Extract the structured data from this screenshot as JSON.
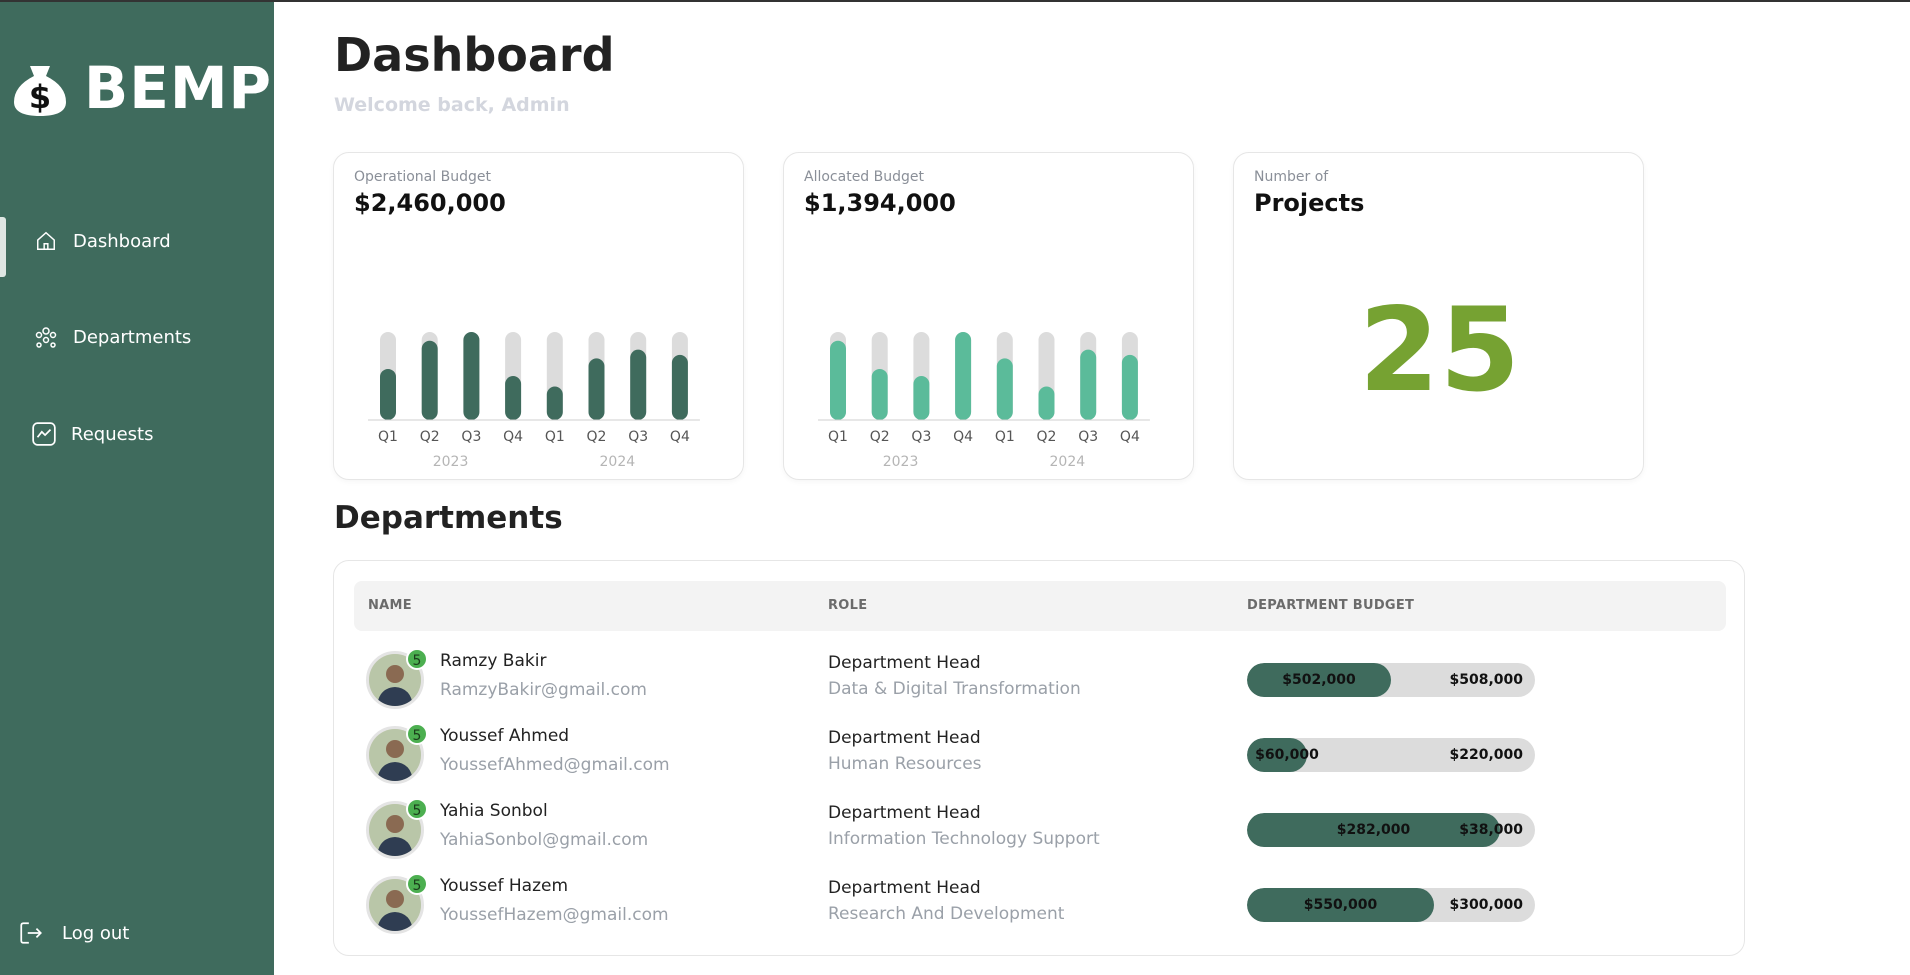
{
  "app": {
    "brand": "BEMP"
  },
  "sidebar": {
    "items": [
      {
        "label": "Dashboard",
        "icon": "home-icon",
        "active": true
      },
      {
        "label": "Departments",
        "icon": "team-icon",
        "active": false
      },
      {
        "label": "Requests",
        "icon": "chart-line-icon",
        "active": false
      }
    ],
    "logout_label": "Log out"
  },
  "header": {
    "title": "Dashboard",
    "subtitle": "Welcome back, Admin"
  },
  "cards": {
    "operational": {
      "label": "Operational Budget",
      "value": "$2,460,000"
    },
    "allocated": {
      "label": "Allocated Budget",
      "value": "$1,394,000"
    },
    "projects": {
      "label": "Number of",
      "value": "Projects",
      "count": "25"
    }
  },
  "chart_data": [
    {
      "type": "bar",
      "title": "",
      "categories": [
        "Q1",
        "Q2",
        "Q3",
        "Q4",
        "Q1",
        "Q2",
        "Q3",
        "Q4"
      ],
      "groups": [
        "2023",
        "2024"
      ],
      "values": [
        0.58,
        0.9,
        1.0,
        0.5,
        0.38,
        0.7,
        0.8,
        0.74
      ],
      "ylim": [
        0,
        1
      ],
      "bar_color": "#3f6b5d",
      "track_color": "#dcdcdc"
    },
    {
      "type": "bar",
      "title": "",
      "categories": [
        "Q1",
        "Q2",
        "Q3",
        "Q4",
        "Q1",
        "Q2",
        "Q3",
        "Q4"
      ],
      "groups": [
        "2023",
        "2024"
      ],
      "values": [
        0.9,
        0.58,
        0.5,
        1.0,
        0.7,
        0.38,
        0.8,
        0.74
      ],
      "ylim": [
        0,
        1
      ],
      "bar_color": "#5bbb9a",
      "track_color": "#dcdcdc"
    }
  ],
  "departments": {
    "title": "Departments",
    "columns": [
      "NAME",
      "ROLE",
      "DEPARTMENT BUDGET"
    ],
    "rows": [
      {
        "name": "Ramzy Bakir",
        "email": "RamzyBakir@gmail.com",
        "badge": "5",
        "role": "Department Head",
        "department": "Data & Digital Transformation",
        "used": "$502,000",
        "remaining": "$508,000",
        "fill": 0.5
      },
      {
        "name": "Youssef Ahmed",
        "email": "YoussefAhmed@gmail.com",
        "badge": "5",
        "role": "Department Head",
        "department": "Human Resources",
        "used": "$60,000",
        "remaining": "$220,000",
        "fill": 0.21
      },
      {
        "name": "Yahia Sonbol",
        "email": "YahiaSonbol@gmail.com",
        "badge": "5",
        "role": "Department Head",
        "department": "Information Technology Support",
        "used": "$282,000",
        "remaining": "$38,000",
        "fill": 0.88
      },
      {
        "name": "Youssef Hazem",
        "email": "YoussefHazem@gmail.com",
        "badge": "5",
        "role": "Department Head",
        "department": "Research And Development",
        "used": "$550,000",
        "remaining": "$300,000",
        "fill": 0.65
      }
    ]
  },
  "colors": {
    "sidebar": "#3f6b5d",
    "accent_green": "#76a232",
    "badge": "#4caf50"
  }
}
